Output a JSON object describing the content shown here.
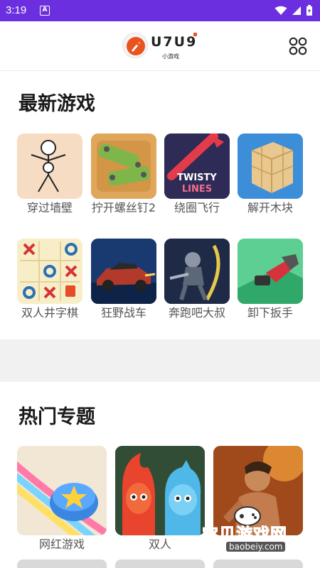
{
  "status_bar": {
    "time": "3:19",
    "notif_letter": "A"
  },
  "header": {
    "logo_text": "U7U9",
    "logo_sub": "小游戏"
  },
  "latest": {
    "title": "最新游戏",
    "games": [
      {
        "name": "穿过墙壁"
      },
      {
        "name": "拧开螺丝钉2"
      },
      {
        "name": "绕圈飞行"
      },
      {
        "name": "解开木块"
      },
      {
        "name": "双人井字棋"
      },
      {
        "name": "狂野战车"
      },
      {
        "name": "奔跑吧大叔"
      },
      {
        "name": "卸下扳手"
      }
    ]
  },
  "hot": {
    "title": "热门专题",
    "topics": [
      {
        "name": "网红游戏"
      },
      {
        "name": "双人"
      },
      {
        "name": ""
      }
    ]
  },
  "watermark": {
    "text": "宝贝游戏网",
    "url": "baobeiy.com"
  },
  "thumb_texts": {
    "twisty": "TWISTY",
    "lines": "LINES"
  },
  "colors": {
    "status_bar": "#6b2fe0",
    "accent": "#e8541e"
  }
}
